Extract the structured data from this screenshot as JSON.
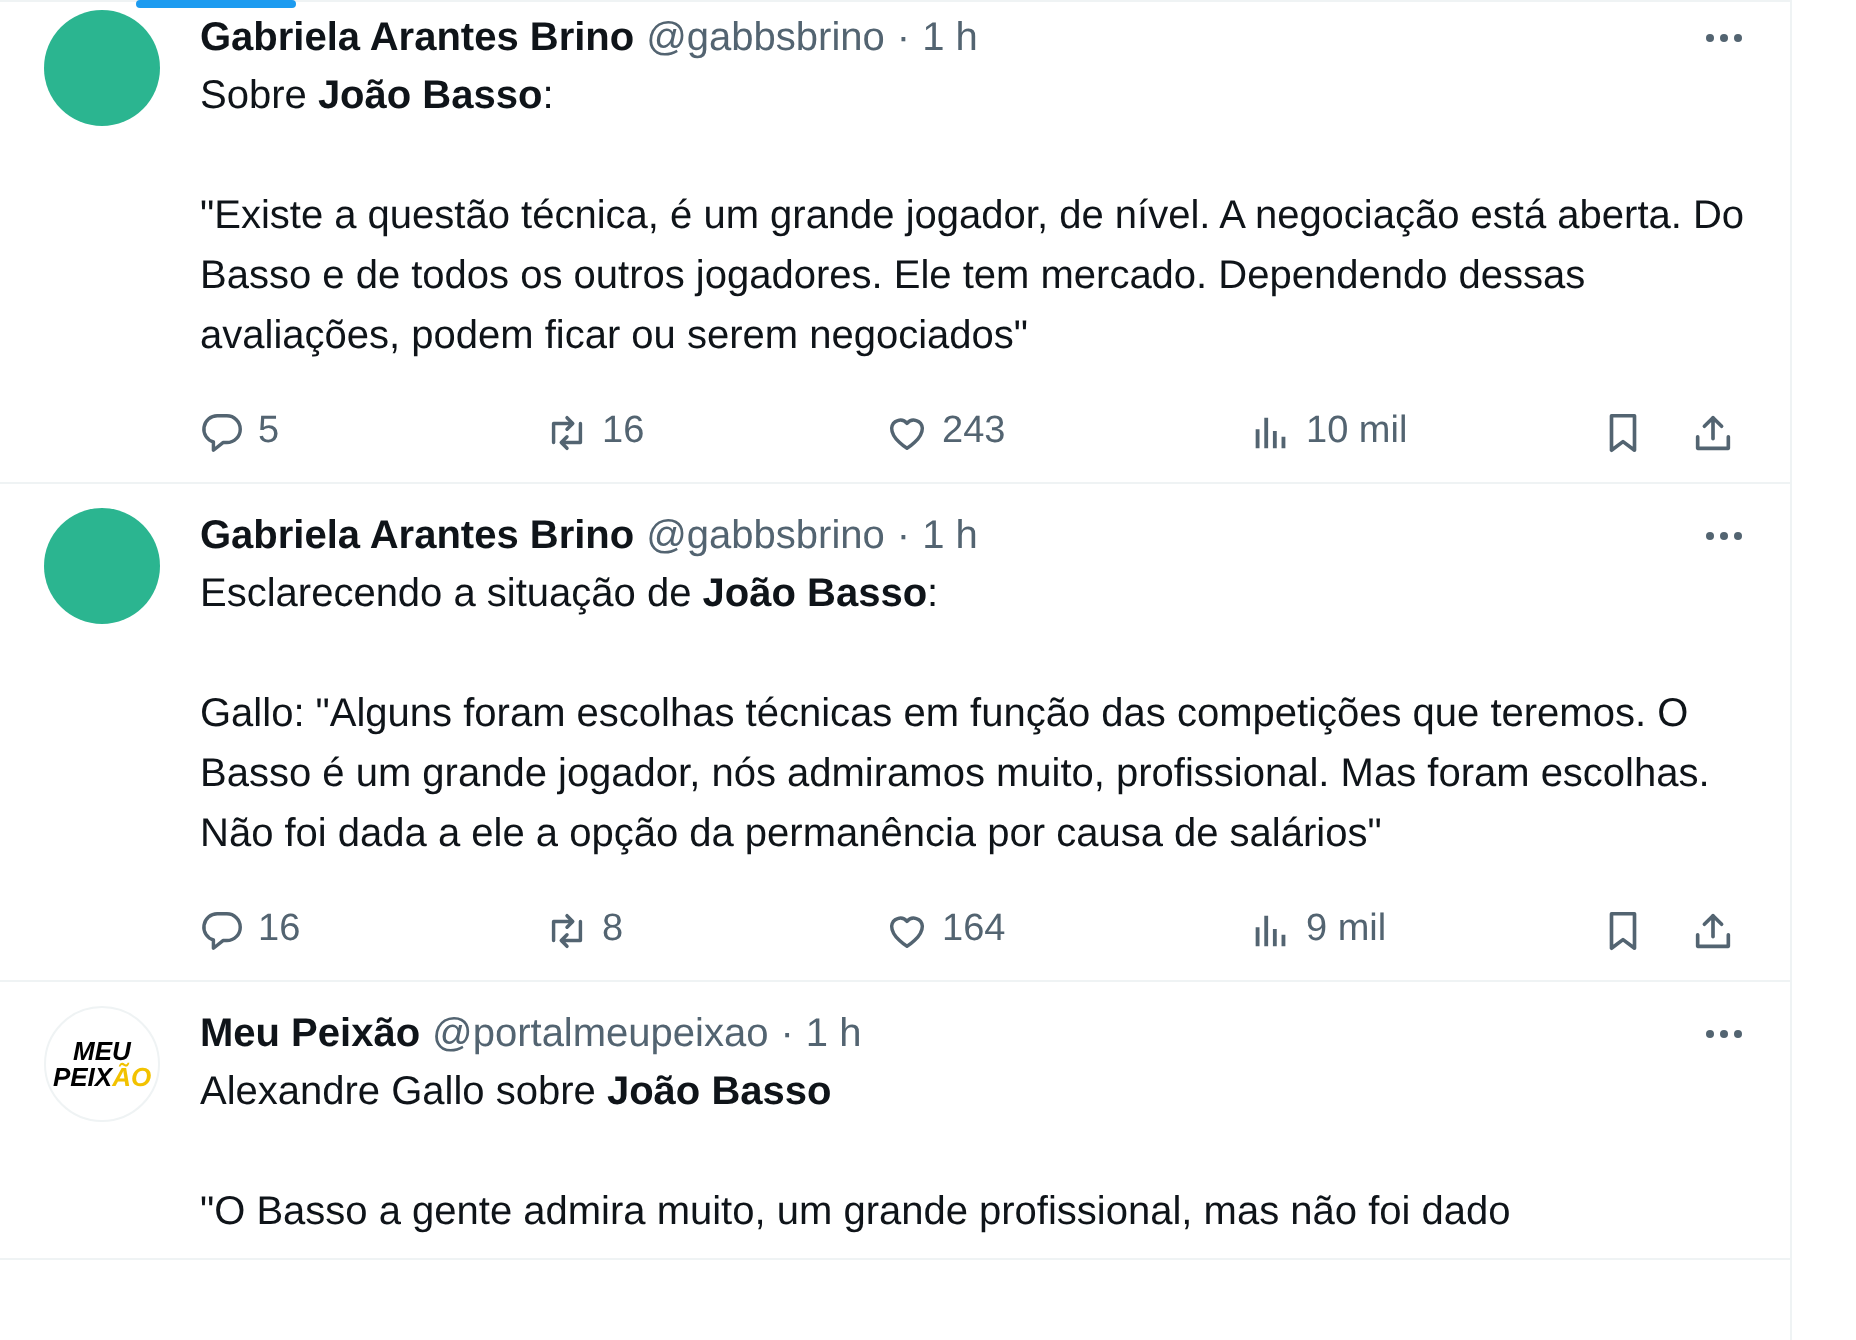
{
  "tweets": [
    {
      "author": "Gabriela Arantes Brino",
      "handle": "@gabbsbrino",
      "separator": "·",
      "time": "1 h",
      "avatar": {
        "kind": "photo"
      },
      "paragraphs": [
        "Sobre **João Basso**:",
        "\"Existe a questão técnica, é um grande jogador, de nível. A negociação está aberta. Do Basso e de todos os outros jogadores. Ele tem mercado. Dependendo dessas avaliações, podem ficar ou serem negociados\""
      ],
      "stats": {
        "replies": "5",
        "reposts": "16",
        "likes": "243",
        "views": "10 mil"
      }
    },
    {
      "author": "Gabriela Arantes Brino",
      "handle": "@gabbsbrino",
      "separator": "·",
      "time": "1 h",
      "avatar": {
        "kind": "photo"
      },
      "paragraphs": [
        "Esclarecendo a situação de **João Basso**:",
        "Gallo: \"Alguns foram escolhas técnicas em função das competições que teremos. O Basso é um grande jogador, nós admiramos muito, profissional. Mas foram escolhas. Não foi dada a ele a opção da permanência por causa de salários\""
      ],
      "stats": {
        "replies": "16",
        "reposts": "8",
        "likes": "164",
        "views": "9 mil"
      }
    },
    {
      "author": "Meu Peixão",
      "handle": "@portalmeupeixao",
      "separator": "·",
      "time": "1 h",
      "avatar": {
        "kind": "logo",
        "line_1": "MEU",
        "line_2": "PEIX",
        "line_2_accent": "ÃO"
      },
      "paragraphs": [
        "Alexandre Gallo sobre **João Basso**",
        "\"O Basso a gente admira muito, um grande profissional, mas não foi dado"
      ]
    }
  ]
}
